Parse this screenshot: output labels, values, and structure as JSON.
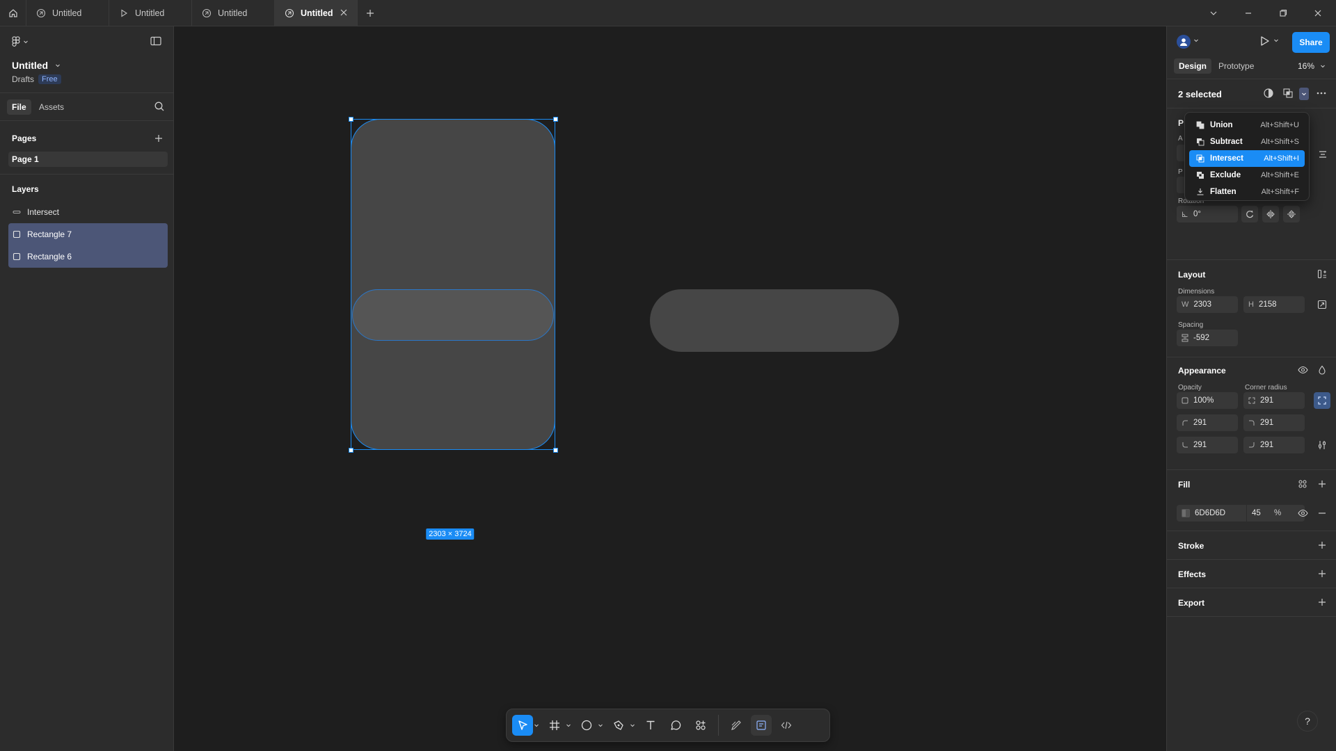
{
  "tabs": [
    {
      "label": "Untitled",
      "icon": "design-file-icon"
    },
    {
      "label": "Untitled",
      "icon": "prototype-play-icon"
    },
    {
      "label": "Untitled",
      "icon": "design-file-icon"
    },
    {
      "label": "Untitled",
      "icon": "design-file-icon",
      "active": true
    }
  ],
  "file": {
    "title": "Untitled",
    "location": "Drafts",
    "plan": "Free"
  },
  "left_tabs": {
    "file": "File",
    "assets": "Assets"
  },
  "pages": {
    "title": "Pages",
    "items": [
      "Page 1"
    ]
  },
  "layers": {
    "title": "Layers",
    "items": [
      {
        "label": "Intersect",
        "icon": "boolean-group-icon",
        "selected": false
      },
      {
        "label": "Rectangle 7",
        "icon": "rectangle-icon",
        "selected": true
      },
      {
        "label": "Rectangle 6",
        "icon": "rectangle-icon",
        "selected": true
      }
    ]
  },
  "canvas": {
    "selection_size": "2303 × 3724"
  },
  "right": {
    "share": "Share",
    "tabs": {
      "design": "Design",
      "prototype": "Prototype"
    },
    "zoom": "16%",
    "selection": "2 selected",
    "rotation": {
      "label": "Rotation",
      "value": "0°"
    },
    "layout": {
      "title": "Layout",
      "dimensions_label": "Dimensions",
      "w_prefix": "W",
      "w": "2303",
      "h_prefix": "H",
      "h": "2158",
      "spacing_label": "Spacing",
      "spacing": "-592"
    },
    "appearance": {
      "title": "Appearance",
      "opacity_label": "Opacity",
      "opacity": "100%",
      "radius_label": "Corner radius",
      "radius": "291",
      "tl": "291",
      "tr": "291",
      "bl": "291",
      "br": "291"
    },
    "fill": {
      "title": "Fill",
      "hex": "6D6D6D",
      "opacity": "45",
      "unit": "%"
    },
    "stroke": "Stroke",
    "effects": "Effects",
    "export": "Export",
    "partial_labels": {
      "p1": "P",
      "a": "A",
      "p2": "P"
    }
  },
  "menu": [
    {
      "label": "Union",
      "shortcut": "Alt+Shift+U",
      "icon": "union-icon"
    },
    {
      "label": "Subtract",
      "shortcut": "Alt+Shift+S",
      "icon": "subtract-icon"
    },
    {
      "label": "Intersect",
      "shortcut": "Alt+Shift+I",
      "icon": "intersect-icon",
      "highlighted": true
    },
    {
      "label": "Exclude",
      "shortcut": "Alt+Shift+E",
      "icon": "exclude-icon"
    },
    {
      "label": "Flatten",
      "shortcut": "Alt+Shift+F",
      "icon": "flatten-icon"
    }
  ],
  "help": "?",
  "colors": {
    "accent": "#1A8CF5",
    "fill": "#6D6D6D",
    "selection_row": "#4C5677"
  }
}
